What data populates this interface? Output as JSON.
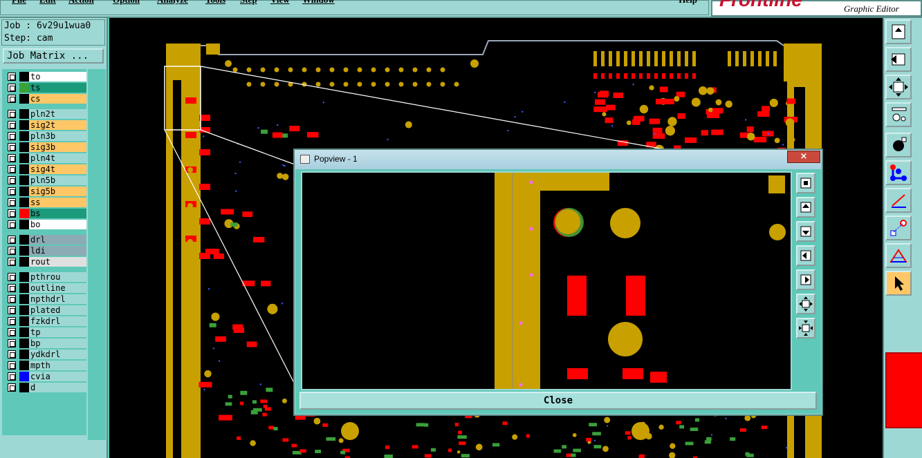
{
  "menu": {
    "items": [
      "File",
      "Edit",
      "Action",
      "Option",
      "Analyze",
      "Tools",
      "Step",
      "View",
      "Window"
    ],
    "help": "Help"
  },
  "brand": {
    "logo": "Frontline",
    "subtitle": "Graphic Editor"
  },
  "job": {
    "job_line": "Job : 6v29u1wua0",
    "step_line": "Step: cam",
    "matrix_button": "Job Matrix ..."
  },
  "layers": [
    {
      "name": "to",
      "bg": "#ffffff",
      "swatch": "#000000"
    },
    {
      "name": "ts",
      "bg": "#1c9a7c",
      "swatch": "#3aa03a"
    },
    {
      "name": "cs",
      "bg": "#ffc766",
      "swatch": "#000000"
    },
    {
      "name": "pln2t",
      "bg": "#9ed8d4",
      "swatch": "#000000"
    },
    {
      "name": "sig2t",
      "bg": "#ffc766",
      "swatch": "#000000"
    },
    {
      "name": "pln3b",
      "bg": "#9ed8d4",
      "swatch": "#000000"
    },
    {
      "name": "sig3b",
      "bg": "#ffc766",
      "swatch": "#000000"
    },
    {
      "name": "pln4t",
      "bg": "#9ed8d4",
      "swatch": "#000000"
    },
    {
      "name": "sig4t",
      "bg": "#ffc766",
      "swatch": "#000000"
    },
    {
      "name": "pln5b",
      "bg": "#9ed8d4",
      "swatch": "#000000"
    },
    {
      "name": "sig5b",
      "bg": "#ffc766",
      "swatch": "#000000"
    },
    {
      "name": "ss",
      "bg": "#ffc766",
      "swatch": "#000000"
    },
    {
      "name": "bs",
      "bg": "#1c9a7c",
      "swatch": "#ff0000"
    },
    {
      "name": "bo",
      "bg": "#ffffff",
      "swatch": "#000000"
    },
    {
      "name": "drl",
      "bg": "#8cabb5",
      "swatch": "#000000"
    },
    {
      "name": "ldi",
      "bg": "#8cabb5",
      "swatch": "#000000"
    },
    {
      "name": "rout",
      "bg": "#e0e0e0",
      "swatch": "#000000"
    },
    {
      "name": "pthrou",
      "bg": "#9ed8d4",
      "swatch": "#000000"
    },
    {
      "name": "outline",
      "bg": "#9ed8d4",
      "swatch": "#000000"
    },
    {
      "name": "npthdrl",
      "bg": "#9ed8d4",
      "swatch": "#000000"
    },
    {
      "name": "plated",
      "bg": "#9ed8d4",
      "swatch": "#000000"
    },
    {
      "name": "fzkdrl",
      "bg": "#9ed8d4",
      "swatch": "#000000"
    },
    {
      "name": "tp",
      "bg": "#9ed8d4",
      "swatch": "#000000"
    },
    {
      "name": "bp",
      "bg": "#9ed8d4",
      "swatch": "#000000"
    },
    {
      "name": "ydkdrl",
      "bg": "#9ed8d4",
      "swatch": "#000000"
    },
    {
      "name": "mpth",
      "bg": "#9ed8d4",
      "swatch": "#000000"
    },
    {
      "name": "cvia",
      "bg": "#9ed8d4",
      "swatch": "#0000ff"
    },
    {
      "name": "d",
      "bg": "#9ed8d4",
      "swatch": "#000000"
    }
  ],
  "popview": {
    "title": "Popview - 1",
    "close_x": "×",
    "close_button": "Close"
  },
  "colors": {
    "copper": "#c8a000",
    "pad": "#ff0000",
    "green": "#3aa03a",
    "panel": "#9ed8d4",
    "teal": "#5fc8b8"
  },
  "toolbar_icons": [
    "zoom-page-icon",
    "zoom-back-icon",
    "fit-icon",
    "measure-icon",
    "select-feature-icon",
    "snap-icon",
    "line-icon",
    "pad-icon",
    "triangle-icon",
    "pointer-icon"
  ],
  "popview_icons": [
    "zoom-fit-icon",
    "zoom-up-icon",
    "zoom-down-icon",
    "pan-left-icon",
    "pan-right-icon",
    "zoom-in-icon",
    "zoom-out-icon"
  ]
}
